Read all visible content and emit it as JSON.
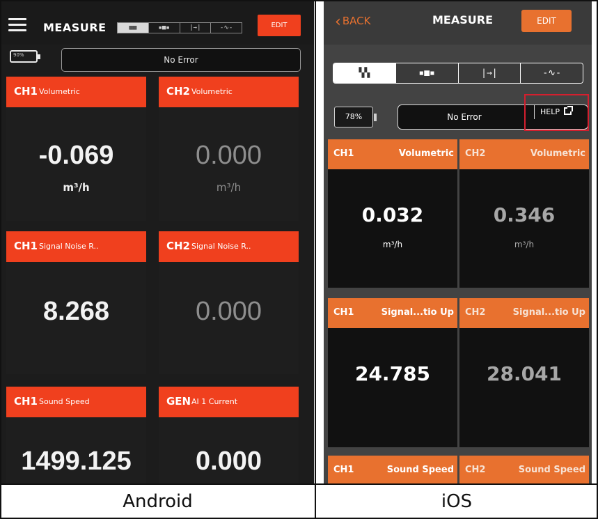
{
  "captions": {
    "android": "Android",
    "ios": "iOS"
  },
  "android": {
    "title": "MEASURE",
    "edit_label": "EDIT",
    "battery": "90%",
    "status": "No Error",
    "view_modes": [
      "grid",
      "single",
      "arrow",
      "wave"
    ],
    "tiles": [
      {
        "channel": "CH1",
        "label": "Volumetric",
        "value": "-0.069",
        "unit": "m³/h"
      },
      {
        "channel": "CH2",
        "label": "Volumetric",
        "value": "0.000",
        "unit": "m³/h"
      },
      {
        "channel": "CH1",
        "label": "Signal Noise R..",
        "value": "8.268"
      },
      {
        "channel": "CH2",
        "label": "Signal Noise R..",
        "value": "0.000"
      },
      {
        "channel": "CH1",
        "label": "Sound Speed",
        "value": "1499.125"
      },
      {
        "channel": "GEN",
        "label": "AI 1 Current",
        "value": "0.000"
      }
    ],
    "colors": {
      "accent": "#f0401e",
      "background": "#1c1c1c"
    }
  },
  "ios": {
    "back_label": "BACK",
    "title": "MEASURE",
    "edit_label": "EDIT",
    "battery": "78%",
    "status": "No Error",
    "help_label": "HELP",
    "view_modes": [
      "grid",
      "single",
      "arrow",
      "wave"
    ],
    "tiles": [
      {
        "channel": "CH1",
        "label": "Volumetric",
        "value": "0.032",
        "unit": "m³/h"
      },
      {
        "channel": "CH2",
        "label": "Volumetric",
        "value": "0.346",
        "unit": "m³/h"
      },
      {
        "channel": "CH1",
        "label": "Signal...tio Up",
        "value": "24.785"
      },
      {
        "channel": "CH2",
        "label": "Signal...tio Up",
        "value": "28.041"
      },
      {
        "channel": "CH1",
        "label": "Sound Speed"
      },
      {
        "channel": "CH2",
        "label": "Sound Speed"
      }
    ],
    "colors": {
      "accent": "#e8712f",
      "background": "#434343",
      "highlight": "#d41f2e"
    }
  }
}
